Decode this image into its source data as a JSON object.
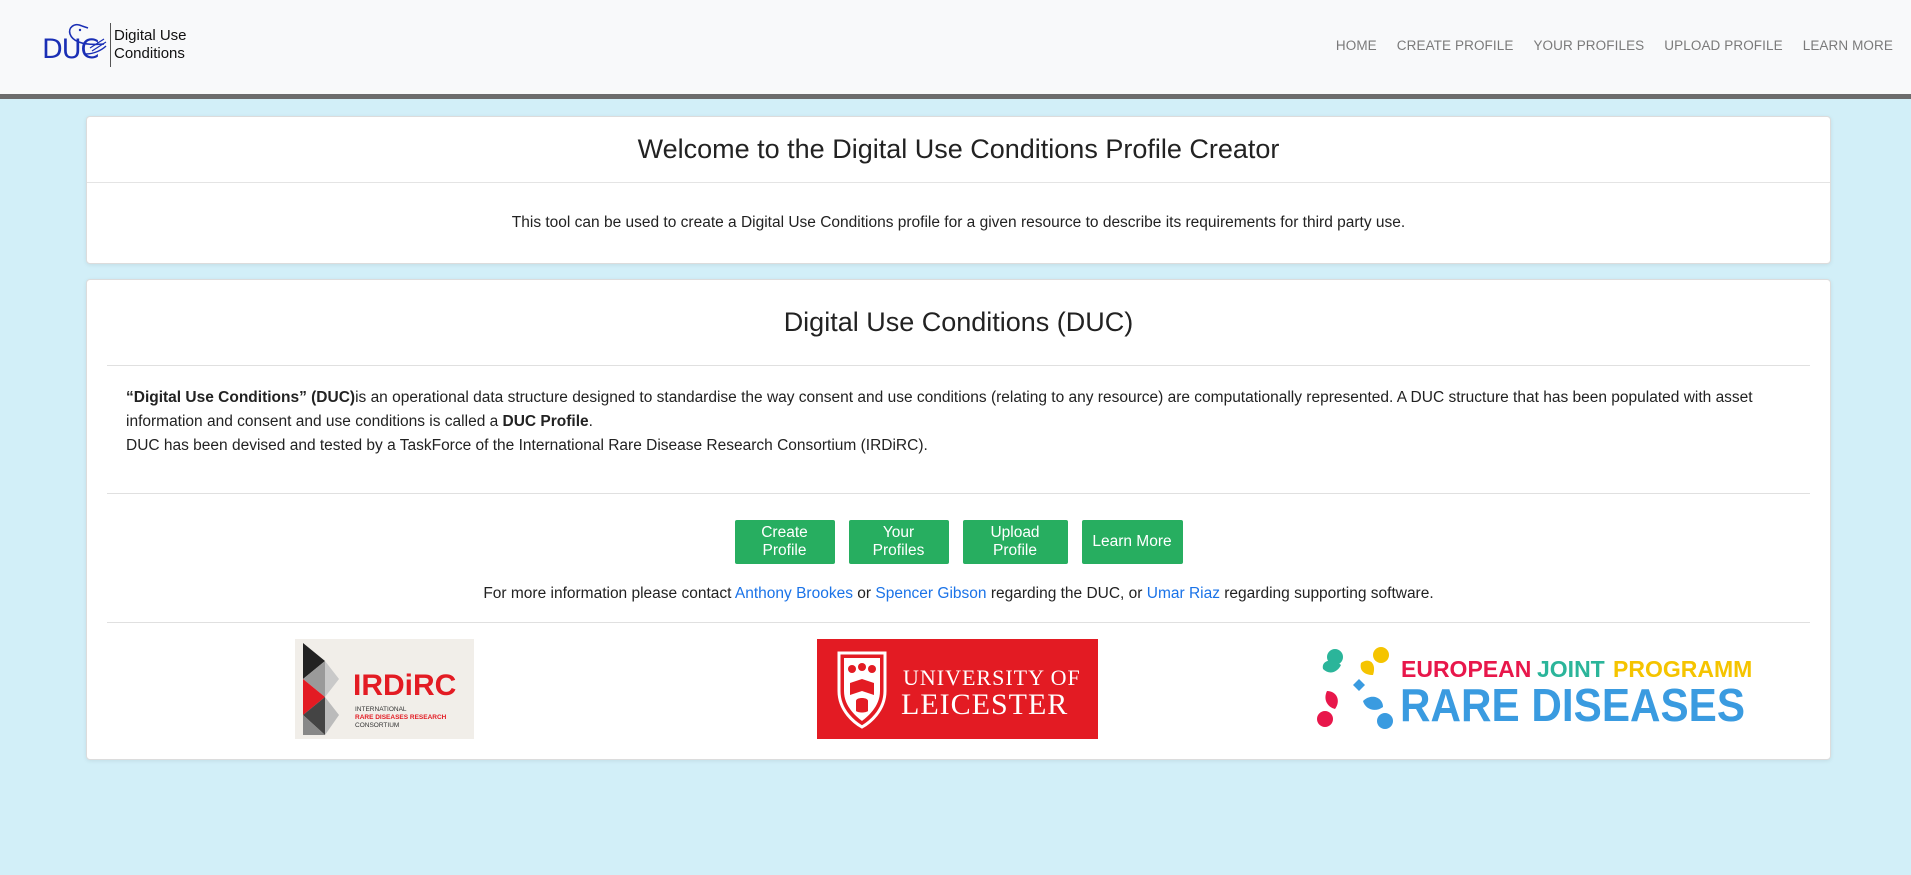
{
  "brand": {
    "logo_text": "DUC",
    "line1": "Digital Use",
    "line2": "Conditions"
  },
  "nav": {
    "home": "HOME",
    "create_profile": "CREATE PROFILE",
    "your_profiles": "YOUR PROFILES",
    "upload_profile": "UPLOAD PROFILE",
    "learn_more": "LEARN MORE"
  },
  "welcome": {
    "title": "Welcome to the Digital Use Conditions Profile Creator",
    "body": "This tool can be used to create a Digital Use Conditions profile for a given resource to describe its requirements for third party use."
  },
  "duc": {
    "title": "Digital Use Conditions (DUC)",
    "term": "“Digital Use Conditions” (DUC)",
    "definition": "is an operational data structure designed to standardise the way consent and use conditions (relating to any resource) are computationally represented. A DUC structure that has been populated with asset information and consent and use conditions is called a ",
    "profile_term": "DUC Profile",
    "period": ".",
    "devised": "DUC has been devised and tested by a TaskForce of the International Rare Disease Research Consortium (IRDiRC)."
  },
  "buttons": {
    "create_profile": "Create Profile",
    "your_profiles": "Your Profiles",
    "upload_profile": "Upload Profile",
    "learn_more": "Learn More"
  },
  "contact": {
    "prefix": "For more information please contact ",
    "person1": "Anthony Brookes",
    "or1": " or ",
    "person2": "Spencer Gibson",
    "mid": " regarding the DUC, or ",
    "person3": "Umar Riaz",
    "suffix": " regarding supporting software."
  },
  "logos": {
    "irdirc": {
      "name": "IRDiRC",
      "line1": "INTERNATIONAL",
      "line2": "RARE DISEASES RESEARCH",
      "line3": "CONSORTIUM"
    },
    "leicester": {
      "line1": "UNIVERSITY OF",
      "line2": "LEICESTER"
    },
    "ejp": {
      "w1": "EUROPEAN",
      "w2": "JOINT",
      "w3": "PROGRAMME",
      "line2": "RARE DISEASES"
    }
  },
  "colors": {
    "background": "#d2eff8",
    "button": "#27ae60",
    "link": "#1a73e8",
    "navbar_border": "#6c6c6c",
    "leicester_red": "#e31b23"
  }
}
